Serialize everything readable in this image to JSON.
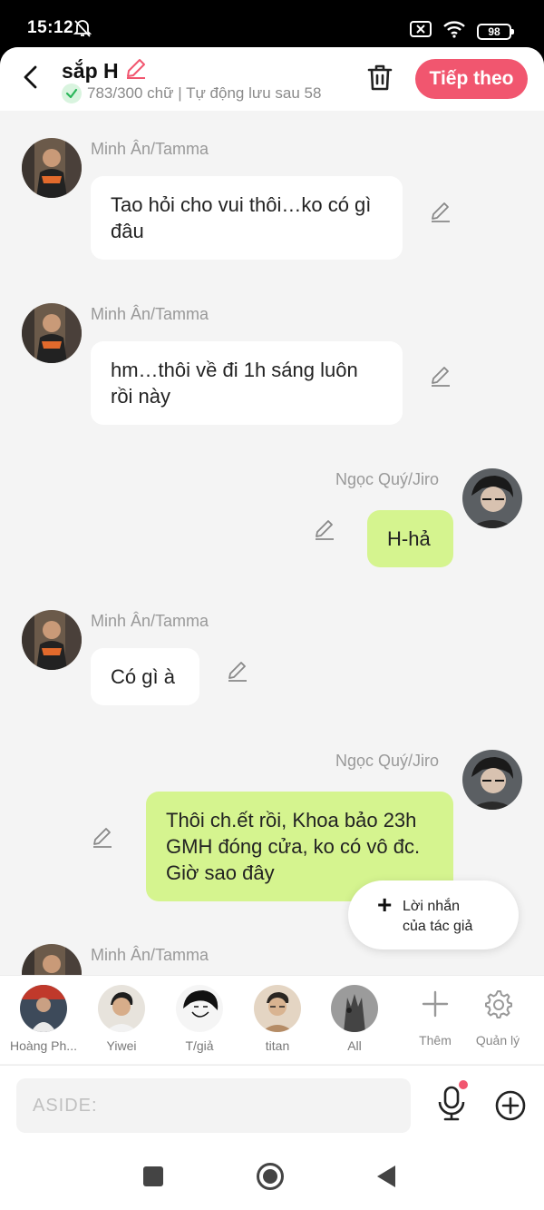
{
  "status_bar": {
    "time": "15:12",
    "battery": "98"
  },
  "header": {
    "title": "sắp H",
    "subtitle": "783/300 chữ | Tự động lưu sau 58",
    "next_label": "Tiếp theo"
  },
  "messages": [
    {
      "sender": "Minh Ân/Tamma",
      "text": "Tao hỏi cho vui thôi…ko có gì đâu",
      "mine": false
    },
    {
      "sender": "Minh Ân/Tamma",
      "text": "hm…thôi về đi 1h sáng luôn rồi này",
      "mine": false
    },
    {
      "sender": "Ngọc Quý/Jiro",
      "text": "H-hả",
      "mine": true
    },
    {
      "sender": "Minh Ân/Tamma",
      "text": "Có gì à",
      "mine": false
    },
    {
      "sender": "Ngọc Quý/Jiro",
      "text": "Thôi ch.ết rồi, Khoa bảo 23h GMH đóng cửa, ko có vô đc. Giờ sao đây",
      "mine": true
    },
    {
      "sender": "Minh Ân/Tamma",
      "text": "",
      "mine": false
    }
  ],
  "author_note_button": {
    "line1": "Lời nhắn",
    "line2": "của tác giả"
  },
  "characters": [
    {
      "name": "Hoàng Ph..."
    },
    {
      "name": "Yiwei"
    },
    {
      "name": "T/giả"
    },
    {
      "name": "titan"
    },
    {
      "name": "All"
    }
  ],
  "tools": {
    "add_label": "Thêm",
    "manage_label": "Quản lý"
  },
  "input": {
    "placeholder": "ASIDE:"
  },
  "colors": {
    "accent": "#f1566f",
    "my_bubble": "#d5f48f",
    "other_bubble": "#ffffff"
  }
}
